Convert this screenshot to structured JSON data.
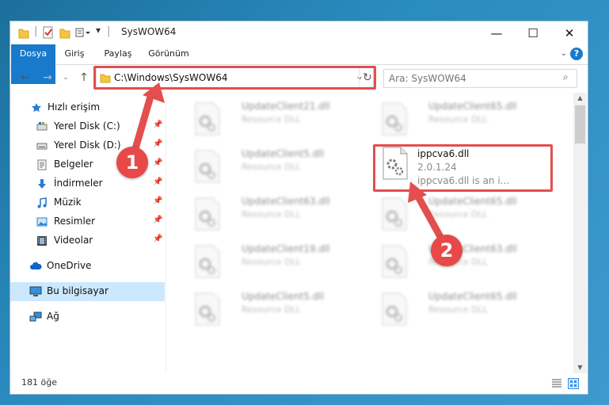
{
  "window": {
    "title": "SysWOW64",
    "controls": {
      "minimize": "—",
      "maximize": "☐",
      "close": "✕"
    }
  },
  "ribbon": {
    "tabs": [
      "Dosya",
      "Giriş",
      "Paylaş",
      "Görünüm"
    ],
    "help": "?"
  },
  "address": {
    "path": "C:\\Windows\\SysWOW64",
    "search_placeholder": "Ara: SysWOW64"
  },
  "sidebar": {
    "items": [
      {
        "label": "Hızlı erişim",
        "icon": "star-icon"
      },
      {
        "label": "Yerel Disk (C:)",
        "icon": "drive-icon",
        "pinned": true
      },
      {
        "label": "Yerel Disk (D:)",
        "icon": "drive-icon",
        "pinned": true
      },
      {
        "label": "Belgeler",
        "icon": "documents-icon",
        "pinned": true
      },
      {
        "label": "İndirmeler",
        "icon": "downloads-icon",
        "pinned": true
      },
      {
        "label": "Müzik",
        "icon": "music-icon",
        "pinned": true
      },
      {
        "label": "Resimler",
        "icon": "pictures-icon",
        "pinned": true
      },
      {
        "label": "Videolar",
        "icon": "videos-icon",
        "pinned": true
      },
      {
        "label": "OneDrive",
        "icon": "cloud-icon"
      },
      {
        "label": "Bu bilgisayar",
        "icon": "computer-icon",
        "selected": true
      },
      {
        "label": "Ağ",
        "icon": "network-icon"
      }
    ]
  },
  "files": [
    {
      "name": "UpdateClient21.dll",
      "desc": "Resource DLL"
    },
    {
      "name": "UpdateClient65.dll",
      "desc": "Resource DLL"
    },
    {
      "name": "UpdateClient5.dll",
      "desc": "Resource DLL"
    },
    {
      "name": "ippcva6.dll",
      "version": "2.0.1.24",
      "desc": "ippcva6.dll is an i..."
    },
    {
      "name": "UpdateClient63.dll",
      "desc": "Resource DLL"
    },
    {
      "name": "UpdateClient65.dll",
      "desc": "Resource DLL"
    },
    {
      "name": "UpdateClient19.dll",
      "desc": "Resource DLL"
    },
    {
      "name": "UpdateClient63.dll",
      "desc": "Resource DLL"
    },
    {
      "name": "UpdateClient5.dll",
      "desc": "Resource DLL"
    },
    {
      "name": "UpdateClient65.dll",
      "desc": "Resource DLL"
    }
  ],
  "status": {
    "count": "181 öğe"
  },
  "annotations": {
    "step1": "1",
    "step2": "2",
    "color": "#e34f4f"
  }
}
